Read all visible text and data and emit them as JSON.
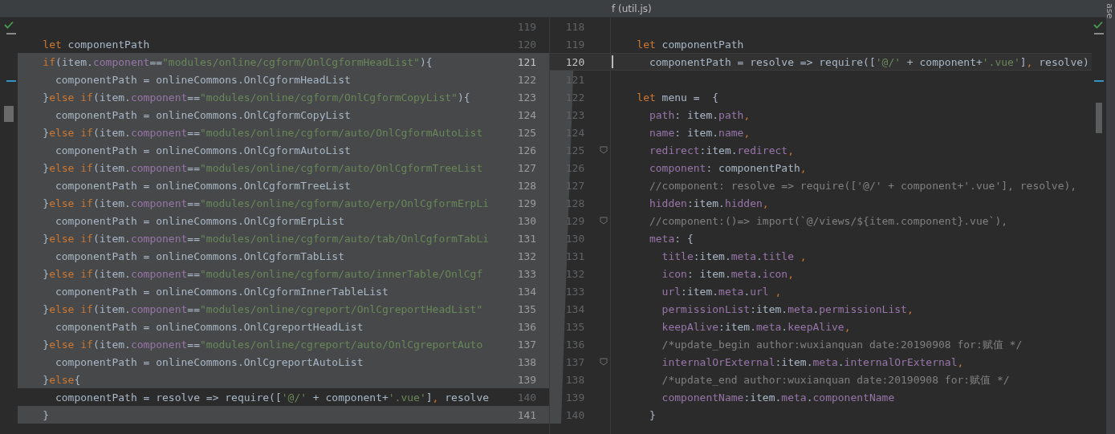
{
  "title_bar": {
    "title": "f (util.js)"
  },
  "side_tab": {
    "label": "ase"
  },
  "left_pane": {
    "rows": [
      {
        "number": "119",
        "changed": false,
        "current": false
      },
      {
        "number": "120",
        "changed": false,
        "current": false,
        "tokens": [
          {
            "text": "    let",
            "kind": "kw"
          },
          {
            "text": " componentPath",
            "kind": "txt"
          }
        ]
      },
      {
        "number": "121",
        "changed": true,
        "current": true,
        "tokens": [
          {
            "text": "    if",
            "kind": "kw"
          },
          {
            "text": "(item.",
            "kind": "txt"
          },
          {
            "text": "component",
            "kind": "prop"
          },
          {
            "text": "==",
            "kind": "txt"
          },
          {
            "text": "\"modules/online/cgform/OnlCgformHeadList\"",
            "kind": "str"
          },
          {
            "text": "){",
            "kind": "txt"
          }
        ]
      },
      {
        "number": "122",
        "changed": true,
        "current": false,
        "tokens": [
          {
            "text": "      componentPath = onlineCommons.OnlCgformHeadList",
            "kind": "txt"
          }
        ]
      },
      {
        "number": "123",
        "changed": true,
        "current": false,
        "tokens": [
          {
            "text": "    }",
            "kind": "txt"
          },
          {
            "text": "else if",
            "kind": "kw"
          },
          {
            "text": "(item.",
            "kind": "txt"
          },
          {
            "text": "component",
            "kind": "prop"
          },
          {
            "text": "==",
            "kind": "txt"
          },
          {
            "text": "\"modules/online/cgform/OnlCgformCopyList\"",
            "kind": "str"
          },
          {
            "text": "){",
            "kind": "txt"
          }
        ]
      },
      {
        "number": "124",
        "changed": true,
        "current": false,
        "tokens": [
          {
            "text": "      componentPath = onlineCommons.OnlCgformCopyList",
            "kind": "txt"
          }
        ]
      },
      {
        "number": "125",
        "changed": true,
        "current": false,
        "tokens": [
          {
            "text": "    }",
            "kind": "txt"
          },
          {
            "text": "else if",
            "kind": "kw"
          },
          {
            "text": "(item.",
            "kind": "txt"
          },
          {
            "text": "component",
            "kind": "prop"
          },
          {
            "text": "==",
            "kind": "txt"
          },
          {
            "text": "\"modules/online/cgform/auto/OnlCgformAutoList",
            "kind": "str"
          }
        ]
      },
      {
        "number": "126",
        "changed": true,
        "current": false,
        "tokens": [
          {
            "text": "      componentPath = onlineCommons.OnlCgformAutoList",
            "kind": "txt"
          }
        ]
      },
      {
        "number": "127",
        "changed": true,
        "current": false,
        "tokens": [
          {
            "text": "    }",
            "kind": "txt"
          },
          {
            "text": "else if",
            "kind": "kw"
          },
          {
            "text": "(item.",
            "kind": "txt"
          },
          {
            "text": "component",
            "kind": "prop"
          },
          {
            "text": "==",
            "kind": "txt"
          },
          {
            "text": "\"modules/online/cgform/auto/OnlCgformTreeList",
            "kind": "str"
          }
        ]
      },
      {
        "number": "128",
        "changed": true,
        "current": false,
        "tokens": [
          {
            "text": "      componentPath = onlineCommons.OnlCgformTreeList",
            "kind": "txt"
          }
        ]
      },
      {
        "number": "129",
        "changed": true,
        "current": false,
        "tokens": [
          {
            "text": "    }",
            "kind": "txt"
          },
          {
            "text": "else if",
            "kind": "kw"
          },
          {
            "text": "(item.",
            "kind": "txt"
          },
          {
            "text": "component",
            "kind": "prop"
          },
          {
            "text": "==",
            "kind": "txt"
          },
          {
            "text": "\"modules/online/cgform/auto/erp/OnlCgformErpLi",
            "kind": "str"
          }
        ]
      },
      {
        "number": "130",
        "changed": true,
        "current": false,
        "tokens": [
          {
            "text": "      componentPath = onlineCommons.OnlCgformErpList",
            "kind": "txt"
          }
        ]
      },
      {
        "number": "131",
        "changed": true,
        "current": false,
        "tokens": [
          {
            "text": "    }",
            "kind": "txt"
          },
          {
            "text": "else if",
            "kind": "kw"
          },
          {
            "text": "(item.",
            "kind": "txt"
          },
          {
            "text": "component",
            "kind": "prop"
          },
          {
            "text": "==",
            "kind": "txt"
          },
          {
            "text": "\"modules/online/cgform/auto/tab/OnlCgformTabLi",
            "kind": "str"
          }
        ]
      },
      {
        "number": "132",
        "changed": true,
        "current": false,
        "tokens": [
          {
            "text": "      componentPath = onlineCommons.OnlCgformTabList",
            "kind": "txt"
          }
        ]
      },
      {
        "number": "133",
        "changed": true,
        "current": false,
        "tokens": [
          {
            "text": "    }",
            "kind": "txt"
          },
          {
            "text": "else if",
            "kind": "kw"
          },
          {
            "text": "(item.",
            "kind": "txt"
          },
          {
            "text": "component",
            "kind": "prop"
          },
          {
            "text": "==",
            "kind": "txt"
          },
          {
            "text": "\"modules/online/cgform/auto/innerTable/OnlCgf",
            "kind": "str"
          }
        ]
      },
      {
        "number": "134",
        "changed": true,
        "current": false,
        "tokens": [
          {
            "text": "      componentPath = onlineCommons.OnlCgformInnerTableList",
            "kind": "txt"
          }
        ]
      },
      {
        "number": "135",
        "changed": true,
        "current": false,
        "tokens": [
          {
            "text": "    }",
            "kind": "txt"
          },
          {
            "text": "else if",
            "kind": "kw"
          },
          {
            "text": "(item.",
            "kind": "txt"
          },
          {
            "text": "component",
            "kind": "prop"
          },
          {
            "text": "==",
            "kind": "txt"
          },
          {
            "text": "\"modules/online/cgreport/OnlCgreportHeadList\"",
            "kind": "str"
          }
        ]
      },
      {
        "number": "136",
        "changed": true,
        "current": false,
        "tokens": [
          {
            "text": "      componentPath = onlineCommons.OnlCgreportHeadList",
            "kind": "txt"
          }
        ]
      },
      {
        "number": "137",
        "changed": true,
        "current": false,
        "tokens": [
          {
            "text": "    }",
            "kind": "txt"
          },
          {
            "text": "else if",
            "kind": "kw"
          },
          {
            "text": "(item.",
            "kind": "txt"
          },
          {
            "text": "component",
            "kind": "prop"
          },
          {
            "text": "==",
            "kind": "txt"
          },
          {
            "text": "\"modules/online/cgreport/auto/OnlCgreportAuto",
            "kind": "str"
          }
        ]
      },
      {
        "number": "138",
        "changed": true,
        "current": false,
        "tokens": [
          {
            "text": "      componentPath = onlineCommons.OnlCgreportAutoList",
            "kind": "txt"
          }
        ]
      },
      {
        "number": "139",
        "changed": true,
        "current": false,
        "tokens": [
          {
            "text": "    }",
            "kind": "txt"
          },
          {
            "text": "else",
            "kind": "kw"
          },
          {
            "text": "{",
            "kind": "txt"
          }
        ]
      },
      {
        "number": "140",
        "changed": false,
        "current": false,
        "tokens": [
          {
            "text": "      componentPath = resolve => require([",
            "kind": "txt"
          },
          {
            "text": "'@/'",
            "kind": "str"
          },
          {
            "text": " + component+",
            "kind": "txt"
          },
          {
            "text": "'.vue'",
            "kind": "str"
          },
          {
            "text": "]",
            "kind": "txt"
          },
          {
            "text": ",",
            "kind": "op"
          },
          {
            "text": " resolve",
            "kind": "txt"
          }
        ]
      },
      {
        "number": "141",
        "changed": true,
        "current": false,
        "tokens": [
          {
            "text": "    }",
            "kind": "txt"
          }
        ]
      }
    ]
  },
  "right_pane": {
    "rows": [
      {
        "number": "118",
        "current": false,
        "fold": false
      },
      {
        "number": "119",
        "current": false,
        "fold": false,
        "tokens": [
          {
            "text": "    let",
            "kind": "kw"
          },
          {
            "text": " componentPath",
            "kind": "txt"
          }
        ]
      },
      {
        "number": "120",
        "current": true,
        "fold": false,
        "tokens": [
          {
            "text": "      componentPath = resolve => require([",
            "kind": "txt"
          },
          {
            "text": "'@/'",
            "kind": "str"
          },
          {
            "text": " + component+",
            "kind": "txt"
          },
          {
            "text": "'.vue'",
            "kind": "str"
          },
          {
            "text": "]",
            "kind": "txt"
          },
          {
            "text": ",",
            "kind": "op"
          },
          {
            "text": " resolve)",
            "kind": "txt"
          }
        ]
      },
      {
        "number": "121",
        "current": false,
        "fold": false
      },
      {
        "number": "122",
        "current": false,
        "fold": false,
        "tokens": [
          {
            "text": "    let",
            "kind": "kw"
          },
          {
            "text": " menu =  {",
            "kind": "txt"
          }
        ]
      },
      {
        "number": "123",
        "current": false,
        "fold": false,
        "tokens": [
          {
            "text": "      path",
            "kind": "prop"
          },
          {
            "text": ": item.",
            "kind": "txt"
          },
          {
            "text": "path",
            "kind": "prop"
          },
          {
            "text": ",",
            "kind": "op"
          }
        ]
      },
      {
        "number": "124",
        "current": false,
        "fold": false,
        "tokens": [
          {
            "text": "      name",
            "kind": "prop"
          },
          {
            "text": ": item.",
            "kind": "txt"
          },
          {
            "text": "name",
            "kind": "prop"
          },
          {
            "text": ",",
            "kind": "op"
          }
        ]
      },
      {
        "number": "125",
        "current": false,
        "fold": true,
        "tokens": [
          {
            "text": "      redirect",
            "kind": "prop"
          },
          {
            "text": ":item.",
            "kind": "txt"
          },
          {
            "text": "redirect",
            "kind": "prop"
          },
          {
            "text": ",",
            "kind": "op"
          }
        ]
      },
      {
        "number": "126",
        "current": false,
        "fold": false,
        "tokens": [
          {
            "text": "      component",
            "kind": "prop"
          },
          {
            "text": ": componentPath",
            "kind": "txt"
          },
          {
            "text": ",",
            "kind": "op"
          }
        ]
      },
      {
        "number": "127",
        "current": false,
        "fold": false,
        "tokens": [
          {
            "text": "      //component: resolve => require(['@/' + component+'.vue'], resolve),",
            "kind": "cmt"
          }
        ]
      },
      {
        "number": "128",
        "current": false,
        "fold": false,
        "tokens": [
          {
            "text": "      hidden",
            "kind": "prop"
          },
          {
            "text": ":item.",
            "kind": "txt"
          },
          {
            "text": "hidden",
            "kind": "prop"
          },
          {
            "text": ",",
            "kind": "op"
          }
        ]
      },
      {
        "number": "129",
        "current": false,
        "fold": true,
        "tokens": [
          {
            "text": "      //component:()=> import(`@/views/${item.component}.vue`),",
            "kind": "cmt"
          }
        ]
      },
      {
        "number": "130",
        "current": false,
        "fold": false,
        "tokens": [
          {
            "text": "      meta",
            "kind": "prop"
          },
          {
            "text": ": {",
            "kind": "txt"
          }
        ]
      },
      {
        "number": "131",
        "current": false,
        "fold": false,
        "tokens": [
          {
            "text": "        title",
            "kind": "prop"
          },
          {
            "text": ":item.",
            "kind": "txt"
          },
          {
            "text": "meta",
            "kind": "prop"
          },
          {
            "text": ".",
            "kind": "txt"
          },
          {
            "text": "title",
            "kind": "prop"
          },
          {
            "text": " ,",
            "kind": "op"
          }
        ]
      },
      {
        "number": "132",
        "current": false,
        "fold": false,
        "tokens": [
          {
            "text": "        icon",
            "kind": "prop"
          },
          {
            "text": ": item.",
            "kind": "txt"
          },
          {
            "text": "meta",
            "kind": "prop"
          },
          {
            "text": ".",
            "kind": "txt"
          },
          {
            "text": "icon",
            "kind": "prop"
          },
          {
            "text": ",",
            "kind": "op"
          }
        ]
      },
      {
        "number": "133",
        "current": false,
        "fold": false,
        "tokens": [
          {
            "text": "        url",
            "kind": "prop"
          },
          {
            "text": ":item.",
            "kind": "txt"
          },
          {
            "text": "meta",
            "kind": "prop"
          },
          {
            "text": ".",
            "kind": "txt"
          },
          {
            "text": "url",
            "kind": "prop"
          },
          {
            "text": " ,",
            "kind": "op"
          }
        ]
      },
      {
        "number": "134",
        "current": false,
        "fold": false,
        "tokens": [
          {
            "text": "        permissionList",
            "kind": "prop"
          },
          {
            "text": ":item.",
            "kind": "txt"
          },
          {
            "text": "meta",
            "kind": "prop"
          },
          {
            "text": ".",
            "kind": "txt"
          },
          {
            "text": "permissionList",
            "kind": "prop"
          },
          {
            "text": ",",
            "kind": "op"
          }
        ]
      },
      {
        "number": "135",
        "current": false,
        "fold": false,
        "tokens": [
          {
            "text": "        keepAlive",
            "kind": "prop"
          },
          {
            "text": ":item.",
            "kind": "txt"
          },
          {
            "text": "meta",
            "kind": "prop"
          },
          {
            "text": ".",
            "kind": "txt"
          },
          {
            "text": "keepAlive",
            "kind": "prop"
          },
          {
            "text": ",",
            "kind": "op"
          }
        ]
      },
      {
        "number": "136",
        "current": false,
        "fold": false,
        "tokens": [
          {
            "text": "        /*update_begin author:wuxianquan date:20190908 for:赋值 */",
            "kind": "cmt"
          }
        ]
      },
      {
        "number": "137",
        "current": false,
        "fold": true,
        "tokens": [
          {
            "text": "        internalOrExternal",
            "kind": "prop"
          },
          {
            "text": ":item.",
            "kind": "txt"
          },
          {
            "text": "meta",
            "kind": "prop"
          },
          {
            "text": ".",
            "kind": "txt"
          },
          {
            "text": "internalOrExternal",
            "kind": "prop"
          },
          {
            "text": ",",
            "kind": "op"
          }
        ]
      },
      {
        "number": "138",
        "current": false,
        "fold": false,
        "tokens": [
          {
            "text": "        /*update_end author:wuxianquan date:20190908 for:赋值 */",
            "kind": "cmt"
          }
        ]
      },
      {
        "number": "139",
        "current": false,
        "fold": false,
        "tokens": [
          {
            "text": "        componentName",
            "kind": "prop"
          },
          {
            "text": ":item.",
            "kind": "txt"
          },
          {
            "text": "meta",
            "kind": "prop"
          },
          {
            "text": ".",
            "kind": "txt"
          },
          {
            "text": "componentName",
            "kind": "prop"
          }
        ]
      },
      {
        "number": "140",
        "current": false,
        "fold": false,
        "tokens": [
          {
            "text": "      }",
            "kind": "txt"
          }
        ]
      }
    ]
  }
}
